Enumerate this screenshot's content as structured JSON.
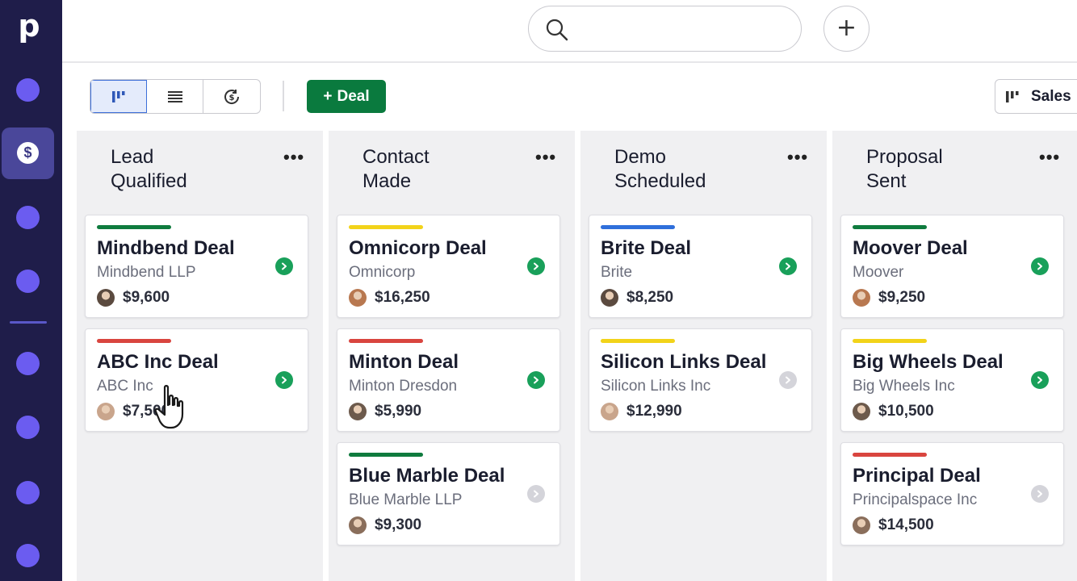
{
  "app": {
    "logo": "p"
  },
  "search": {
    "placeholder": ""
  },
  "toolbar": {
    "add_deal": "Deal",
    "pipeline_label": "Sales"
  },
  "colors": {
    "green": "#0f7b3e",
    "yellow": "#f2d31a",
    "red": "#d9453f",
    "blue": "#2f6fdb"
  },
  "columns": [
    {
      "title_line1": "Lead",
      "title_line2": "Qualified",
      "cards": [
        {
          "title": "Mindbend Deal",
          "org": "Mindbend LLP",
          "value": "$9,600",
          "bar": "green",
          "status": "active"
        },
        {
          "title": "ABC Inc Deal",
          "org": "ABC Inc",
          "value": "$7,500",
          "bar": "red",
          "status": "active"
        }
      ]
    },
    {
      "title_line1": "Contact",
      "title_line2": "Made",
      "cards": [
        {
          "title": "Omnicorp Deal",
          "org": "Omnicorp",
          "value": "$16,250",
          "bar": "yellow",
          "status": "active"
        },
        {
          "title": "Minton Deal",
          "org": "Minton Dresdon",
          "value": "$5,990",
          "bar": "red",
          "status": "active"
        },
        {
          "title": "Blue Marble Deal",
          "org": "Blue Marble LLP",
          "value": "$9,300",
          "bar": "green",
          "status": "inactive"
        }
      ]
    },
    {
      "title_line1": "Demo",
      "title_line2": "Scheduled",
      "cards": [
        {
          "title": "Brite Deal",
          "org": "Brite",
          "value": "$8,250",
          "bar": "blue",
          "status": "active"
        },
        {
          "title": "Silicon Links Deal",
          "org": "Silicon Links Inc",
          "value": "$12,990",
          "bar": "yellow",
          "status": "inactive"
        }
      ]
    },
    {
      "title_line1": "Proposal",
      "title_line2": "Sent",
      "cards": [
        {
          "title": "Moover Deal",
          "org": "Moover",
          "value": "$9,250",
          "bar": "green",
          "status": "active"
        },
        {
          "title": "Big Wheels Deal",
          "org": "Big Wheels Inc",
          "value": "$10,500",
          "bar": "yellow",
          "status": "active"
        },
        {
          "title": "Principal Deal",
          "org": "Principalspace Inc",
          "value": "$14,500",
          "bar": "red",
          "status": "inactive"
        }
      ]
    }
  ]
}
